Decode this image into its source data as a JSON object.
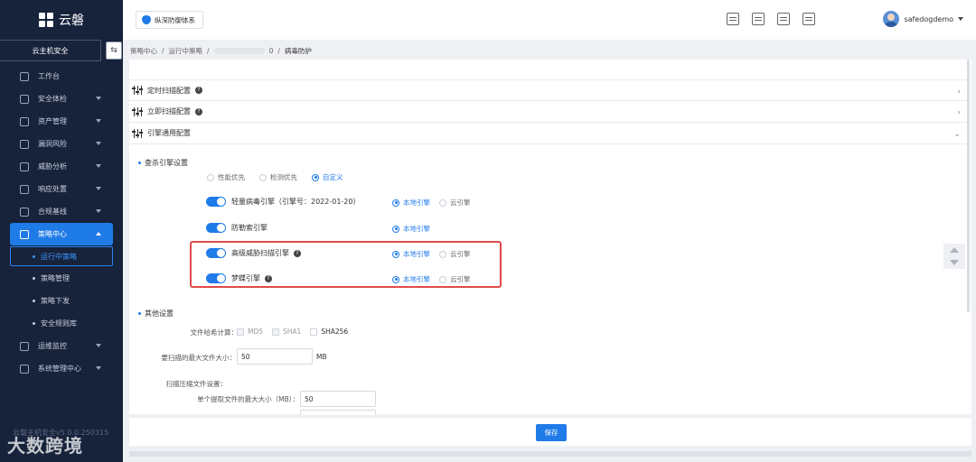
{
  "sidebar": {
    "brand": "云磐",
    "section_title": "云主机安全",
    "collapse_icon": "collapse-icon",
    "items": [
      {
        "label": "工作台",
        "icon": "workbench-icon",
        "arrow": false
      },
      {
        "label": "安全体检",
        "icon": "checkup-icon",
        "arrow": true
      },
      {
        "label": "资产管理",
        "icon": "asset-icon",
        "arrow": true
      },
      {
        "label": "漏洞风险",
        "icon": "vuln-icon",
        "arrow": true
      },
      {
        "label": "威胁分析",
        "icon": "threat-icon",
        "arrow": true
      },
      {
        "label": "响应处置",
        "icon": "response-icon",
        "arrow": true
      },
      {
        "label": "合规基线",
        "icon": "baseline-icon",
        "arrow": true
      },
      {
        "label": "策略中心",
        "icon": "policy-icon",
        "arrow": true,
        "active": true
      }
    ],
    "sub_items": [
      "运行中策略",
      "策略管理",
      "策略下发",
      "安全规则库"
    ],
    "items_after": [
      {
        "label": "运维监控",
        "icon": "monitor-icon"
      },
      {
        "label": "系统管理中心",
        "icon": "settings-icon"
      }
    ],
    "version": "云磐主机安全v5.0.0.250315"
  },
  "header": {
    "tab_label": "纵深防御体系",
    "username": "safedogdemo",
    "icons": [
      "screen-icon",
      "server-icon",
      "document-icon",
      "alert-icon"
    ]
  },
  "breadcrumb": {
    "items": [
      "策略中心",
      "运行中策略",
      "0",
      "病毒防护"
    ]
  },
  "accordion": [
    {
      "label": "定时扫描配置",
      "help": true,
      "state": "collapsed"
    },
    {
      "label": "立即扫描配置",
      "help": true,
      "state": "collapsed"
    },
    {
      "label": "引擎通用配置",
      "help": false,
      "state": "expanded"
    }
  ],
  "engine_settings": {
    "title": "查杀引擎设置",
    "modes": [
      {
        "label": "性能优先",
        "selected": false
      },
      {
        "label": "检测优先",
        "selected": false
      },
      {
        "label": "自定义",
        "selected": true
      }
    ],
    "engines": [
      {
        "label": "轻量病毒引擎（引擎号：2022-01-20）",
        "help": false,
        "enabled": true,
        "local": "本地引擎",
        "cloud": "云引擎",
        "selected": "local"
      },
      {
        "label": "防勒索引擎",
        "help": false,
        "enabled": true,
        "local": "本地引擎",
        "cloud": null,
        "selected": "local"
      },
      {
        "label": "高级威胁扫描引擎",
        "help": true,
        "enabled": true,
        "local": "本地引擎",
        "cloud": "云引擎",
        "selected": "local"
      },
      {
        "label": "梦蝶引擎",
        "help": true,
        "enabled": true,
        "local": "本地引擎",
        "cloud": "云引擎",
        "selected": "local"
      }
    ]
  },
  "other_settings": {
    "title": "其他设置",
    "hash_label": "文件哈希计算：",
    "hash_options": [
      {
        "label": "MD5",
        "enabled": false
      },
      {
        "label": "SHA1",
        "enabled": false
      },
      {
        "label": "SHA256",
        "enabled": true
      }
    ],
    "max_size_label": "要扫描的最大文件大小：",
    "max_size_value": "50",
    "max_size_unit": "MB",
    "archive_label": "扫描压缩文件设置：",
    "extract_label": "单个提取文件的最大大小（MB）：",
    "extract_value": "50"
  },
  "actions": {
    "save_label": "保存"
  },
  "watermark": "大数跨境"
}
